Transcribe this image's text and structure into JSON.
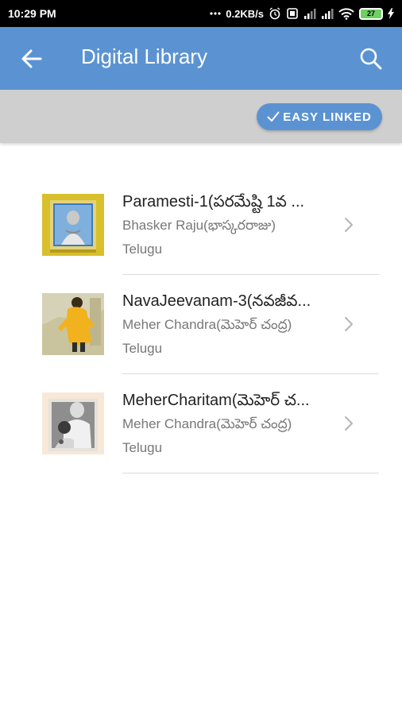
{
  "status_bar": {
    "time": "10:29 PM",
    "speed": "0.2KB/s",
    "battery": "27",
    "icons": [
      "dots-icon",
      "alarm-icon",
      "sim-icon",
      "signal-icon",
      "signal-icon",
      "wifi-icon",
      "battery-icon",
      "charging-icon"
    ]
  },
  "app_bar": {
    "title": "Digital Library",
    "back_icon": "arrow-left-icon",
    "search_icon": "search-icon",
    "color": "#5b93d2"
  },
  "sub_bar": {
    "easy_linked_label": "EASY LINKED",
    "check_icon": "check-icon"
  },
  "books": [
    {
      "title": "Paramesti-1(పరమేష్టి 1వ ...",
      "author": "Bhasker Raju(భాస్కరరాజు)",
      "language": "Telugu"
    },
    {
      "title": "NavaJeevanam-3(నవజీవ...",
      "author": "Meher Chandra(మెహెర్ చంద్ర)",
      "language": "Telugu"
    },
    {
      "title": "MeherCharitam(మెహెర్ చ...",
      "author": "Meher Chandra(మెహెర్ చంద్ర)",
      "language": "Telugu"
    }
  ]
}
